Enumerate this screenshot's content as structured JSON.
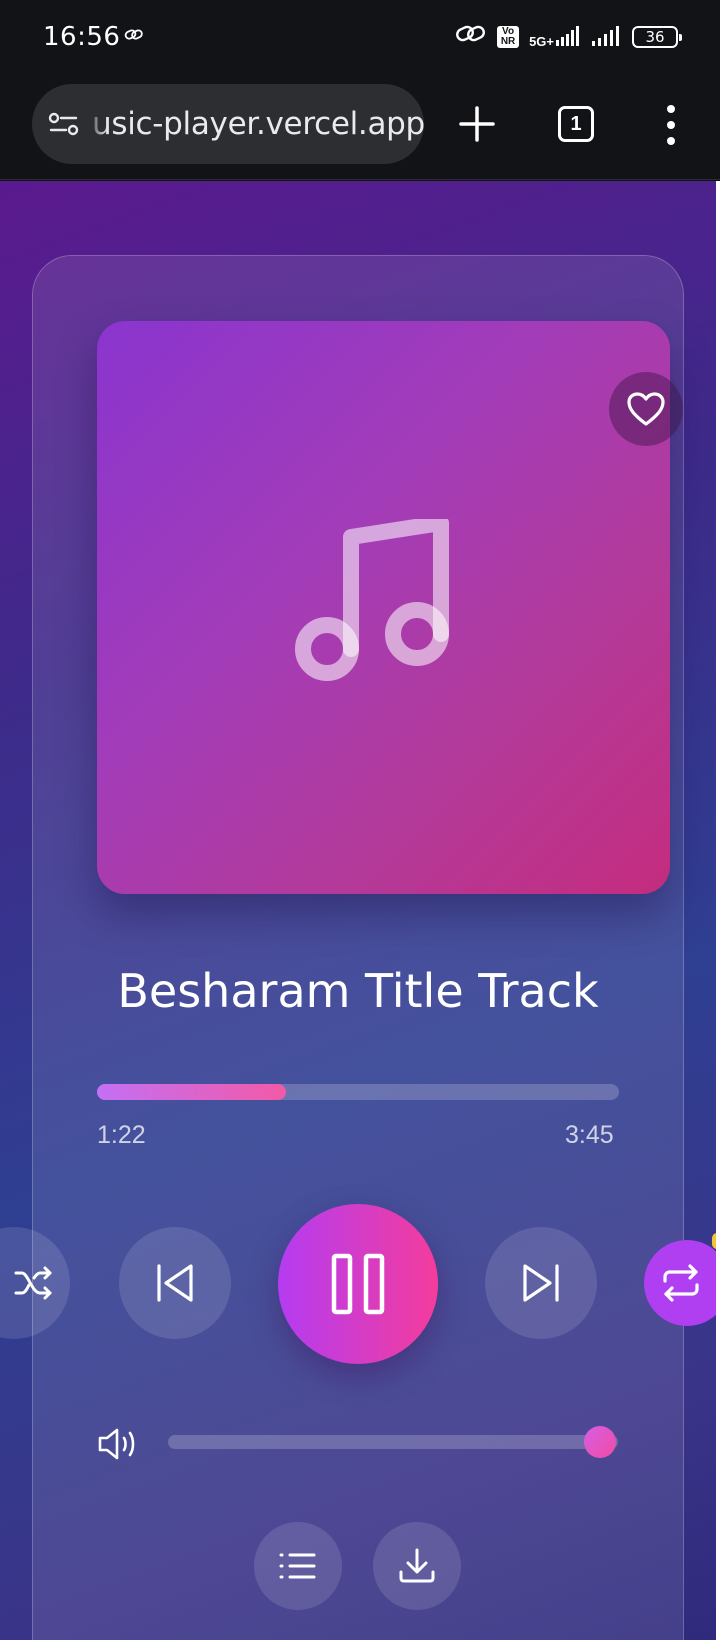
{
  "status_bar": {
    "time": "16:56",
    "network_label": "5G+",
    "volte_label": "Vo NR",
    "battery": "36"
  },
  "browser": {
    "url": "usic-player.vercel.app",
    "tab_count": "1"
  },
  "player": {
    "track_title": "Besharam Title Track",
    "time_current": "1:22",
    "time_total": "3:45",
    "progress_fraction": 0.363,
    "volume_fraction": 0.96,
    "is_playing": true,
    "favorite": false,
    "repeat_active": true,
    "shuffle_active": false
  },
  "colors": {
    "accent_gradient_start": "#b43cf2",
    "accent_gradient_end": "#f43c9c",
    "album_gradient_start": "#8a35cf",
    "album_gradient_end": "#c42c7e"
  },
  "icons": {
    "favorite": "heart-icon",
    "album_art": "music-note-icon",
    "shuffle": "shuffle-icon",
    "previous": "skip-previous-icon",
    "play_pause": "pause-icon",
    "next": "skip-next-icon",
    "repeat": "repeat-icon",
    "volume": "volume-icon",
    "playlist": "playlist-icon",
    "download": "download-icon"
  }
}
